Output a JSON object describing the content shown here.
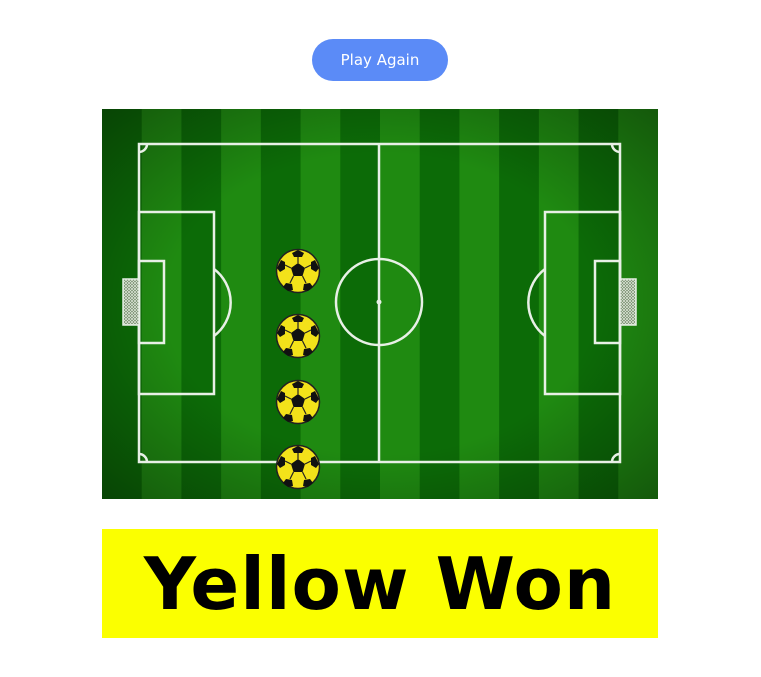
{
  "controls": {
    "play_again_label": "Play Again"
  },
  "pitch": {
    "stripe_colors": [
      "#0c6b07",
      "#1f8a11"
    ],
    "line_color": "#e8f0e6",
    "goal_net_color": "#cfd8cc"
  },
  "balls": {
    "color": "yellow",
    "count": 4,
    "fill": "#f3e21a",
    "patch_color": "#111111"
  },
  "result": {
    "text": "Yellow Won",
    "background": "#fbff00"
  }
}
